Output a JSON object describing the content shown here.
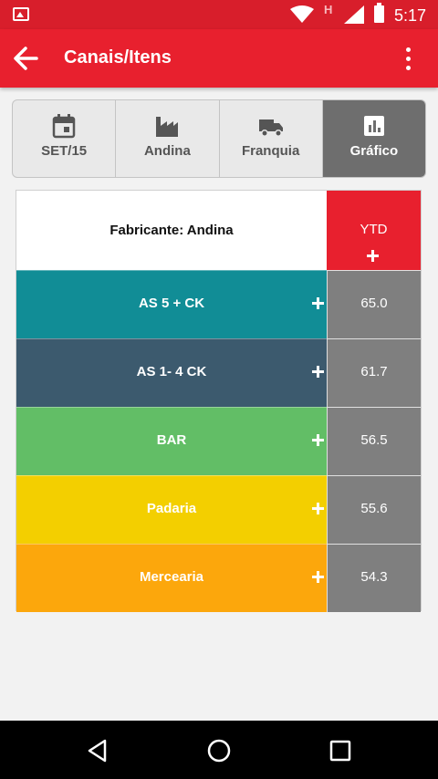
{
  "status_bar": {
    "time": "5:17",
    "network_label": "H"
  },
  "app_bar": {
    "title": "Canais/Itens"
  },
  "tabs": [
    {
      "label": "SET/15",
      "icon": "calendar-icon",
      "active": false
    },
    {
      "label": "Andina",
      "icon": "factory-icon",
      "active": false
    },
    {
      "label": "Franquia",
      "icon": "truck-icon",
      "active": false
    },
    {
      "label": "Gráfico",
      "icon": "bar-chart-icon",
      "active": true
    }
  ],
  "table": {
    "header_label": "Fabricante: Andina",
    "ytd_label": "YTD",
    "rows": [
      {
        "label": "AS 5 + CK",
        "value": "65.0",
        "color": "#118d96"
      },
      {
        "label": "AS 1- 4 CK",
        "value": "61.7",
        "color": "#3c5a6e"
      },
      {
        "label": "BAR",
        "value": "56.5",
        "color": "#62be66"
      },
      {
        "label": "Padaria",
        "value": "55.6",
        "color": "#f3cf00"
      },
      {
        "label": "Mercearia",
        "value": "54.3",
        "color": "#fca70c"
      }
    ]
  },
  "colors": {
    "primary": "#e8202e",
    "status_bar": "#d81e2b",
    "active_tab": "#6e6e6e",
    "value_cell": "#7f7f7f"
  }
}
